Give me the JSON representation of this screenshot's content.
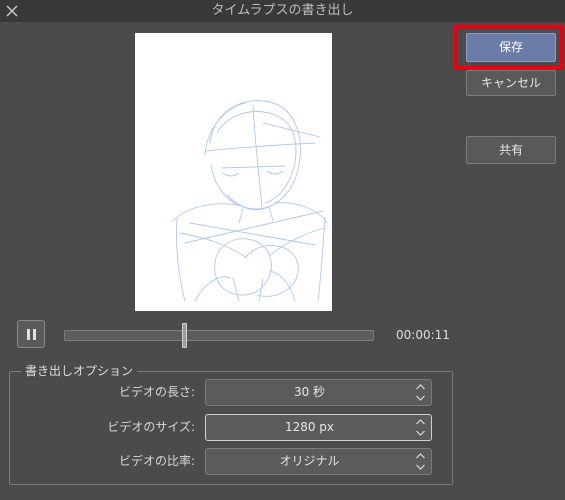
{
  "window": {
    "title": "タイムラプスの書き出し"
  },
  "actions": {
    "save_label": "保存",
    "cancel_label": "キャンセル",
    "share_label": "共有"
  },
  "playback": {
    "time": "00:00:11",
    "progress": 0.39
  },
  "options": {
    "legend": "書き出しオプション",
    "fields": [
      {
        "label": "ビデオの長さ:",
        "value": "30 秒"
      },
      {
        "label": "ビデオのサイズ:",
        "value": "1280 px"
      },
      {
        "label": "ビデオの比率:",
        "value": "オリジナル"
      }
    ]
  },
  "icons": {
    "close": "close-icon",
    "pause": "pause-icon",
    "stepper_up": "chevron-up-icon",
    "stepper_down": "chevron-down-icon"
  },
  "colors": {
    "accent": "#6b7ca8",
    "highlight": "#e60012",
    "sketch": "#a6c2ec"
  }
}
